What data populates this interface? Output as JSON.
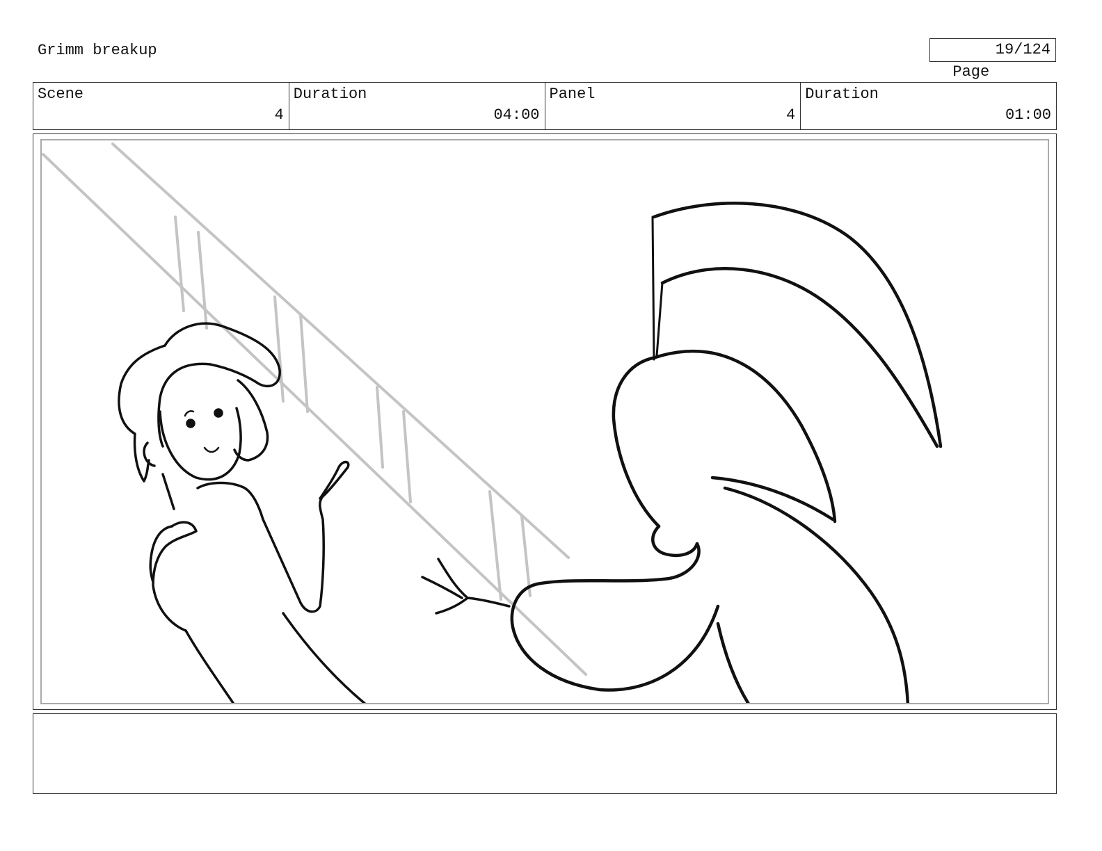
{
  "header": {
    "project_title": "Grimm breakup",
    "page_label": "Page",
    "page_number": "19/124"
  },
  "info": [
    {
      "label": "Scene",
      "value": "4"
    },
    {
      "label": "Duration",
      "value": "04:00"
    },
    {
      "label": "Panel",
      "value": "4"
    },
    {
      "label": "Duration",
      "value": "01:00"
    }
  ],
  "panel": {
    "drawing": "storyboard-sketch"
  },
  "notes": {
    "text": ""
  }
}
